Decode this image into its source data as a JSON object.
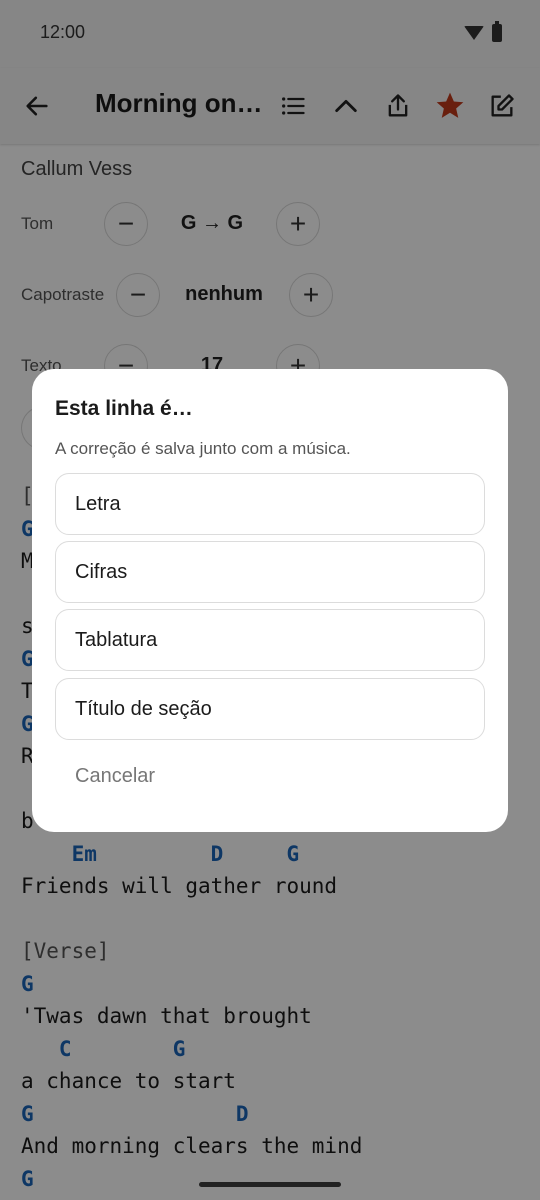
{
  "status": {
    "time": "12:00"
  },
  "appbar": {
    "title": "Morning on t…"
  },
  "song": {
    "artist": "Callum Vess",
    "controls": [
      {
        "label": "Tom",
        "value": "G → G"
      },
      {
        "label": "Capotraste",
        "value": "nenhum"
      },
      {
        "label": "Texto",
        "value": "17"
      }
    ],
    "partial_lines": [
      "[",
      "G",
      "M",
      "s",
      "G",
      "T",
      "G",
      "R",
      "b"
    ],
    "lines": [
      "    Em         D     G",
      "Friends will gather round",
      "[Verse]",
      "G",
      "'Twas dawn that brought",
      "   C        G",
      "a chance to start",
      "G                D",
      "And morning clears the mind",
      "G"
    ]
  },
  "dialog": {
    "title": "Esta linha é…",
    "subtitle": "A correção é salva junto com a música.",
    "options": [
      "Letra",
      "Cifras",
      "Tablatura",
      "Título de seção"
    ],
    "cancel": "Cancelar"
  },
  "colors": {
    "accent_star": "#c0391b",
    "chord": "#1a64b8"
  }
}
